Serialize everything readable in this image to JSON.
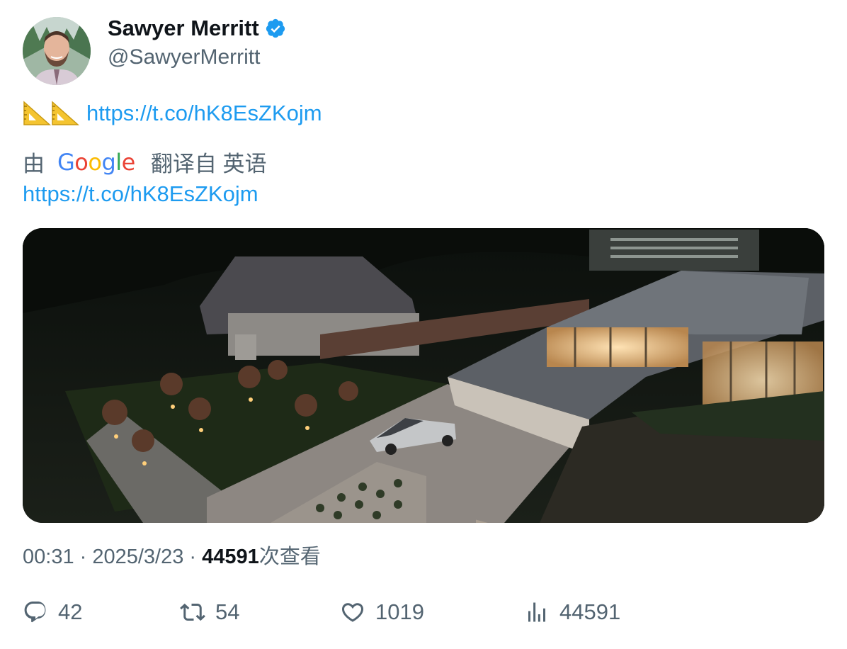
{
  "author": {
    "name": "Sawyer Merritt",
    "handle": "@SawyerMerritt",
    "verified_icon": "verified-badge-icon",
    "verified_color": "#1d9bf0"
  },
  "tweet": {
    "emoji": "📐📐",
    "link": "https://t.co/hK8EsZKojm",
    "translation": {
      "by_label": "由",
      "provider": "Google",
      "suffix": "翻译自 英语",
      "link": "https://t.co/hK8EsZKojm"
    },
    "media": {
      "alt": "",
      "kind": "photo"
    }
  },
  "meta": {
    "time": "00:31",
    "sep1": " · ",
    "date": "2025/3/23",
    "sep2": " · ",
    "views_count": "44591",
    "views_label": "次查看"
  },
  "actions": {
    "replies": "42",
    "retweets": "54",
    "likes": "1019",
    "views": "44591"
  },
  "colors": {
    "link": "#1d9bf0",
    "secondary_text": "#536471",
    "primary_text": "#0f1419"
  }
}
